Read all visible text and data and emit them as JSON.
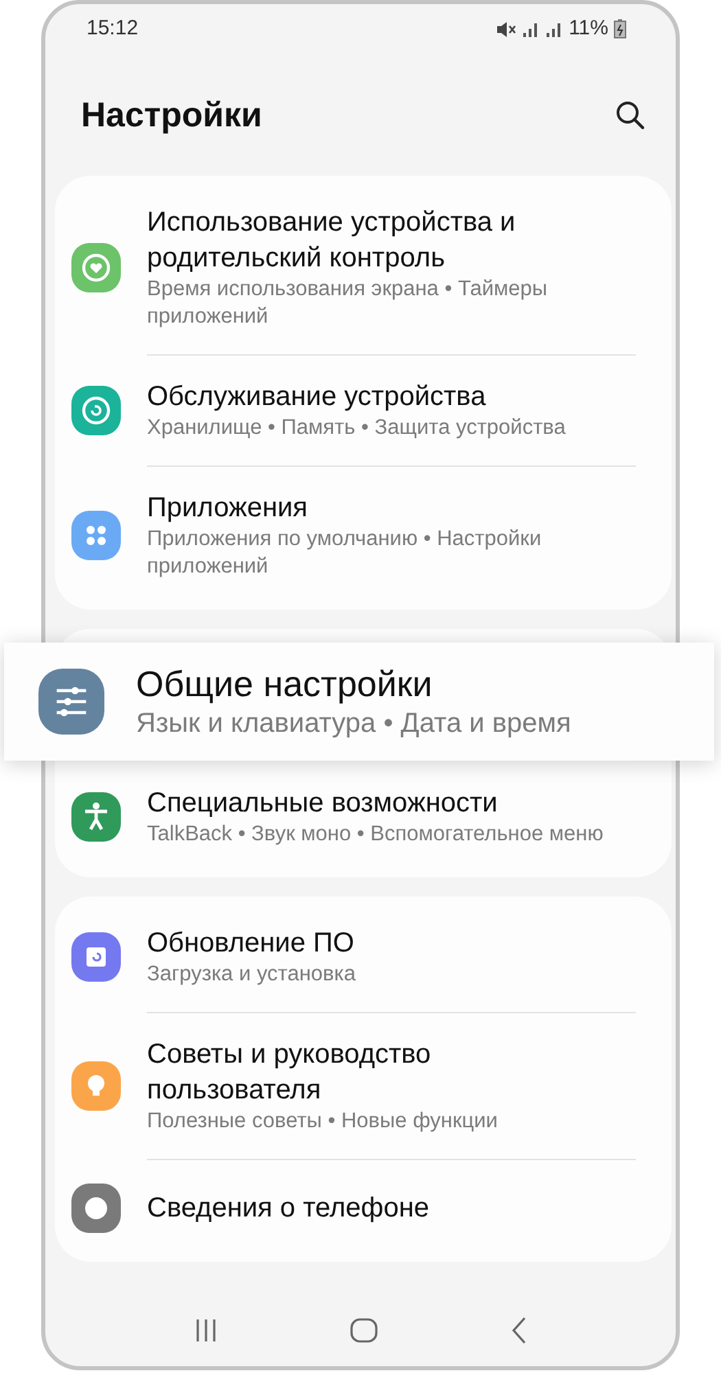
{
  "status_bar": {
    "time": "15:12",
    "battery": "11%"
  },
  "header": {
    "title": "Настройки"
  },
  "groups": [
    {
      "items": [
        {
          "title": "Использование устройства и родительский контроль",
          "subtitle": "Время использования экрана • Таймеры приложений",
          "color": "#6cc36a",
          "selected": false
        },
        {
          "title": "Обслуживание устройства",
          "subtitle": "Хранилище • Память • Защита устройства",
          "color": "#1bb39a",
          "selected": false
        },
        {
          "title": "Приложения",
          "subtitle": "Приложения по умолчанию • Настройки приложений",
          "color": "#6aaaf5",
          "selected": false
        }
      ]
    },
    {
      "items": [
        {
          "title": "Общие настройки",
          "subtitle": "Язык и клавиатура • Дата и время",
          "color": "#64839f",
          "selected": true
        },
        {
          "title": "Специальные возможности",
          "subtitle": "TalkBack • Звук моно • Вспомогательное меню",
          "color": "#2f9a5a",
          "selected": false
        }
      ]
    },
    {
      "items": [
        {
          "title": "Обновление ПО",
          "subtitle": "Загрузка и установка",
          "color": "#7479f0",
          "selected": false
        },
        {
          "title": "Советы и руководство пользователя",
          "subtitle": "Полезные советы • Новые функции",
          "color": "#fba54a",
          "selected": false
        },
        {
          "title": "Сведения о телефоне",
          "color": "#7a7a7a",
          "selected": false
        }
      ]
    }
  ]
}
